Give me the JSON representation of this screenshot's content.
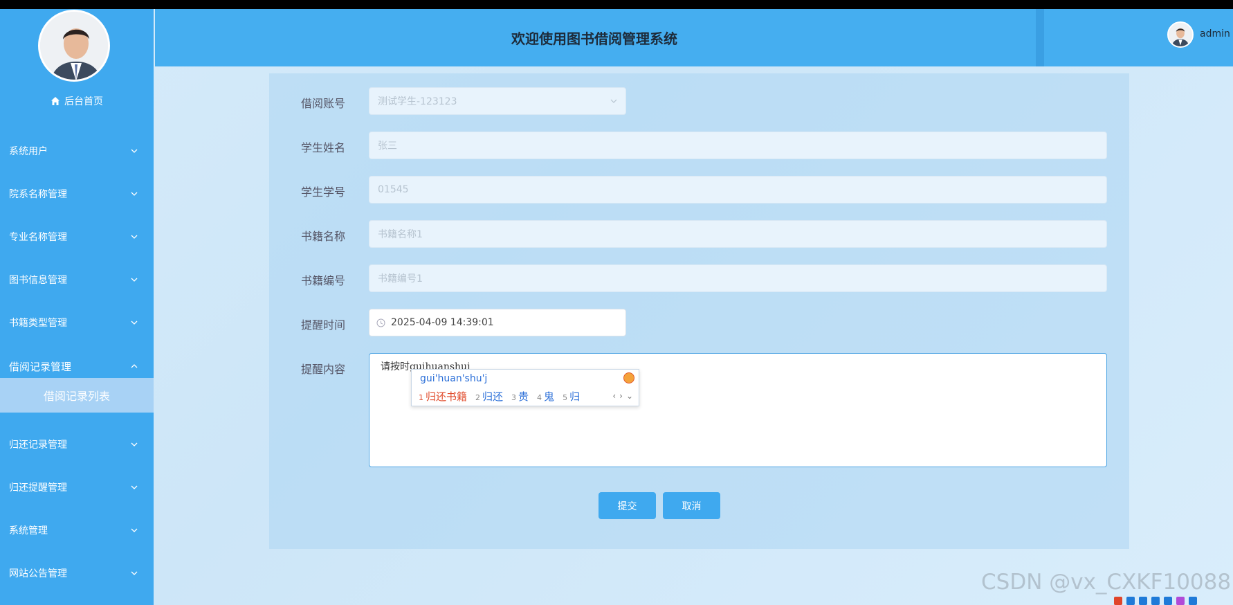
{
  "header": {
    "title": "欢迎使用图书借阅管理系统",
    "username": "admin"
  },
  "sidebar": {
    "home_label": "后台首页",
    "items": [
      {
        "label": "系统用户",
        "expanded": false
      },
      {
        "label": "院系名称管理",
        "expanded": false
      },
      {
        "label": "专业名称管理",
        "expanded": false
      },
      {
        "label": "图书信息管理",
        "expanded": false
      },
      {
        "label": "书籍类型管理",
        "expanded": false
      },
      {
        "label": "借阅记录管理",
        "expanded": true
      },
      {
        "label": "归还记录管理",
        "expanded": false
      },
      {
        "label": "归还提醒管理",
        "expanded": false
      },
      {
        "label": "系统管理",
        "expanded": false
      },
      {
        "label": "网站公告管理",
        "expanded": false
      }
    ],
    "active_subitem": "借阅记录列表"
  },
  "form": {
    "borrow_account_label": "借阅账号",
    "borrow_account_value": "测试学生-123123",
    "student_name_label": "学生姓名",
    "student_name_value": "张三",
    "student_id_label": "学生学号",
    "student_id_value": "01545",
    "book_name_label": "书籍名称",
    "book_name_value": "书籍名称1",
    "book_code_label": "书籍编号",
    "book_code_value": "书籍编号1",
    "remind_time_label": "提醒时间",
    "remind_time_value": "2025-04-09 14:39:01",
    "remind_content_label": "提醒内容",
    "remind_content_value": "请按时guihuanshuj",
    "submit_label": "提交",
    "cancel_label": "取消"
  },
  "ime": {
    "pinyin": "gui'huan'shu'j",
    "candidates": [
      {
        "num": "1",
        "text": "归还书籍"
      },
      {
        "num": "2",
        "text": "归还"
      },
      {
        "num": "3",
        "text": "贵"
      },
      {
        "num": "4",
        "text": "鬼"
      },
      {
        "num": "5",
        "text": "归"
      }
    ],
    "nav": [
      "‹",
      "›",
      "⌄"
    ]
  },
  "watermark": "CSDN @vx_CXKF10088",
  "colors": {
    "primary": "#3fa9ef",
    "header": "#45aef0",
    "active_sub": "#a8d2f5"
  }
}
